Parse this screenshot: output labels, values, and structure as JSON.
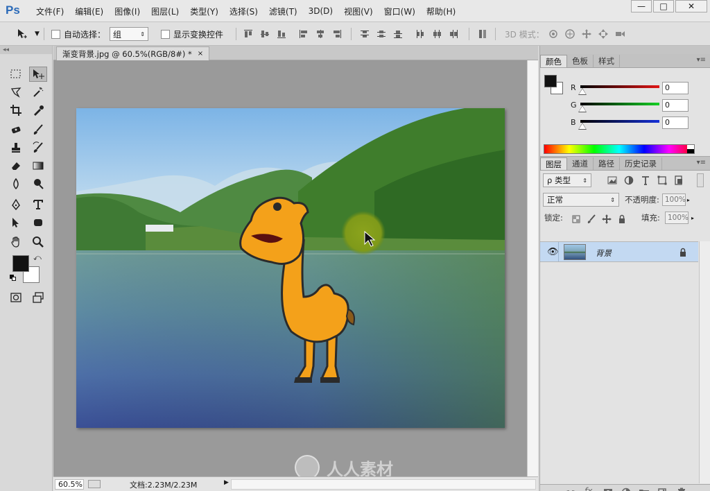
{
  "app": {
    "logo": "Ps"
  },
  "menu": [
    "文件(F)",
    "编辑(E)",
    "图像(I)",
    "图层(L)",
    "类型(Y)",
    "选择(S)",
    "滤镜(T)",
    "3D(D)",
    "视图(V)",
    "窗口(W)",
    "帮助(H)"
  ],
  "window_controls": {
    "minimize": "—",
    "maximize": "□",
    "close": "✕"
  },
  "options": {
    "auto_select_label": "自动选择：",
    "auto_select_value": "组",
    "transform_controls_label": "显示变换控件",
    "mode_3d_label": "3D 模式："
  },
  "document": {
    "tab_title": "渐变背景.jpg @ 60.5%(RGB/8#) *",
    "tab_close": "×"
  },
  "status": {
    "zoom": "60.5%",
    "doc_info": "文档:2.23M/2.23M"
  },
  "color_panel": {
    "tabs": [
      "颜色",
      "色板",
      "样式"
    ],
    "sliders": [
      {
        "label": "R",
        "value": "0",
        "color": "#d01010"
      },
      {
        "label": "G",
        "value": "0",
        "color": "#10b020"
      },
      {
        "label": "B",
        "value": "0",
        "color": "#1020c0"
      }
    ]
  },
  "layers_panel": {
    "tabs": [
      "图层",
      "通道",
      "路径",
      "历史记录"
    ],
    "filter_label": "ρ 类型",
    "blend_mode": "正常",
    "opacity_label": "不透明度:",
    "opacity_value": "100%",
    "lock_label": "锁定:",
    "fill_label": "填充:",
    "fill_value": "100%",
    "layers": [
      {
        "name": "背景",
        "visible": true,
        "locked": true
      }
    ]
  },
  "watermark": "人人素材"
}
